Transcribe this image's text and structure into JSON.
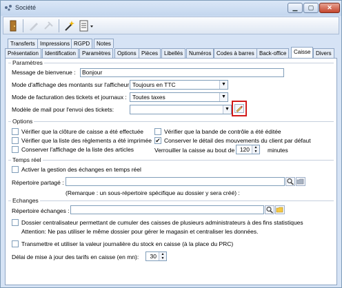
{
  "window": {
    "title": "Société"
  },
  "tabs_row1": [
    "Transferts",
    "Impressions",
    "RGPD",
    "Notes"
  ],
  "tabs_row2": [
    "Présentation",
    "Identification",
    "Paramètres",
    "Options",
    "Pièces",
    "Libellés",
    "Numéros",
    "Codes à barres",
    "Back-office",
    "Caisse",
    "Divers"
  ],
  "active_tab": "Caisse",
  "parametres": {
    "title": "Paramètres",
    "welcome_label": "Message de bienvenue :",
    "welcome_value": "Bonjour",
    "display_label": "Mode d'affichage des montants sur l'afficheur :",
    "display_value": "Toujours en TTC",
    "billing_label": "Mode de facturation des tickets et journaux :",
    "billing_value": "Toutes taxes",
    "mail_label": "Modèle de mail pour l'envoi des tickets:",
    "mail_value": ""
  },
  "options": {
    "title": "Options",
    "items": [
      {
        "label": "Vérifier que la clôture de caisse a été effectuée",
        "checked": false
      },
      {
        "label": "Vérifier que la liste des règlements a été imprimée",
        "checked": false
      },
      {
        "label": "Conserver l'affichage de la liste des articles",
        "checked": false
      },
      {
        "label": "Vérifier que la bande de contrôle a été éditée",
        "checked": false
      },
      {
        "label": "Conserver le détail des mouvements du client par défaut",
        "checked": true
      }
    ],
    "lock_label": "Verrouiller la caisse au bout de",
    "lock_value": "120",
    "lock_unit": "minutes"
  },
  "temps_reel": {
    "title": "Temps réel",
    "activate_label": "Activer la gestion des échanges en temps réel",
    "shared_dir_label": "Répertoire partagé :",
    "shared_dir_value": "",
    "remark": "(Remarque : un sous-répertoire spécifique au dossier y sera créé) :"
  },
  "echanges": {
    "title": "Echanges",
    "dir_label": "Répertoire échanges :",
    "dir_value": "",
    "central_label": "Dossier centralisateur permettant de cumuler des caisses de plusieurs administrateurs à des fins statistiques",
    "central_note": "Attention: Ne pas utiliser le même dossier pour gérer le magasin et centraliser les données.",
    "stock_label": "Transmettre et utiliser la valeur journalière du stock en caisse (à la place du PRC)",
    "delay_label": "Délai de mise à jour des tarifs en caisse (en mn):",
    "delay_value": "30"
  },
  "colors": {
    "highlight": "#d11a1a",
    "window_bg": "#d6e3f5"
  }
}
